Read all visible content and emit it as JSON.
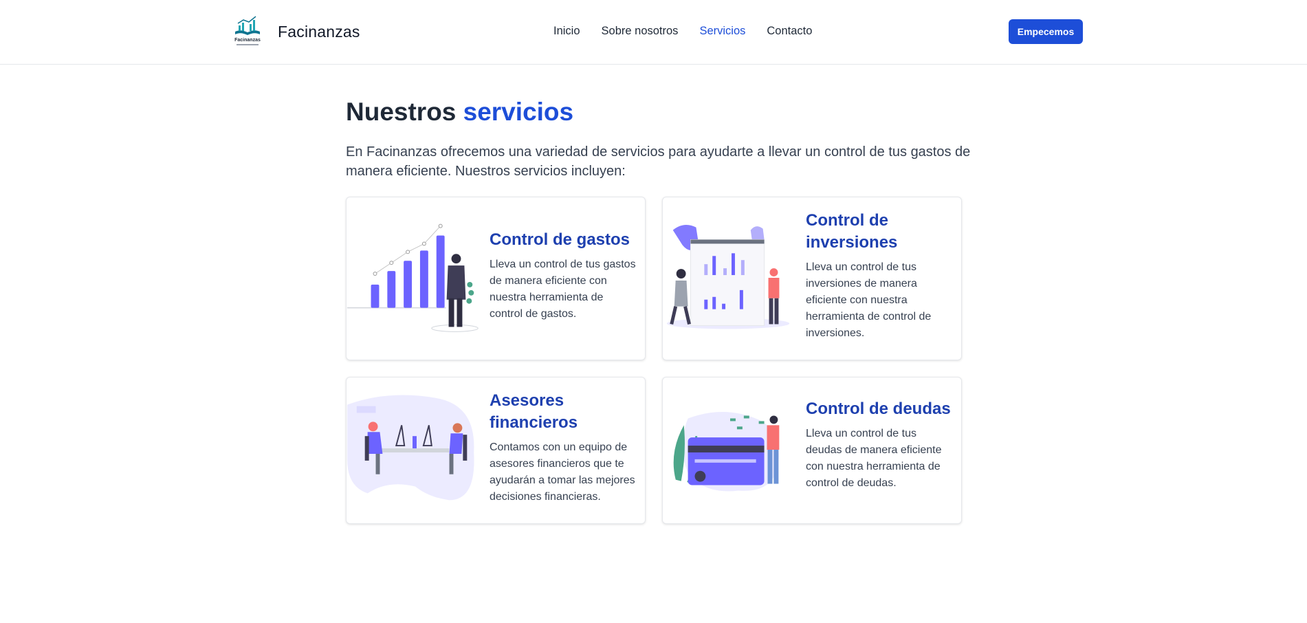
{
  "header": {
    "brand": "Facinanzas",
    "logo_text": "Facinanzas",
    "nav": [
      "Inicio",
      "Sobre nosotros",
      "Servicios",
      "Contacto"
    ],
    "active_nav": "Servicios",
    "cta_label": "Empecemos"
  },
  "section": {
    "title_plain": "Nuestros ",
    "title_accent": "servicios",
    "intro": "En Facinanzas ofrecemos una variedad de servicios para ayudarte a llevar un control de tus gastos de manera eficiente. Nuestros servicios incluyen:"
  },
  "cards": [
    {
      "title": "Control de gastos",
      "text": "Lleva un control de tus gastos de manera eficiente con nuestra herramienta de control de gastos."
    },
    {
      "title": "Control de inversiones",
      "text": "Lleva un control de tus inversiones de manera eficiente con nuestra herramienta de control de inversiones."
    },
    {
      "title": "Asesores financieros",
      "text": "Contamos con un equipo de asesores financieros que te ayudarán a tomar las mejores decisiones financieras."
    },
    {
      "title": "Control de deudas",
      "text": "Lleva un control de tus deudas de manera eficiente con nuestra herramienta de control de deudas."
    }
  ],
  "colors": {
    "accent": "#1d4ed8",
    "card_title": "#1e40af",
    "illustration_purple": "#6c63ff"
  }
}
